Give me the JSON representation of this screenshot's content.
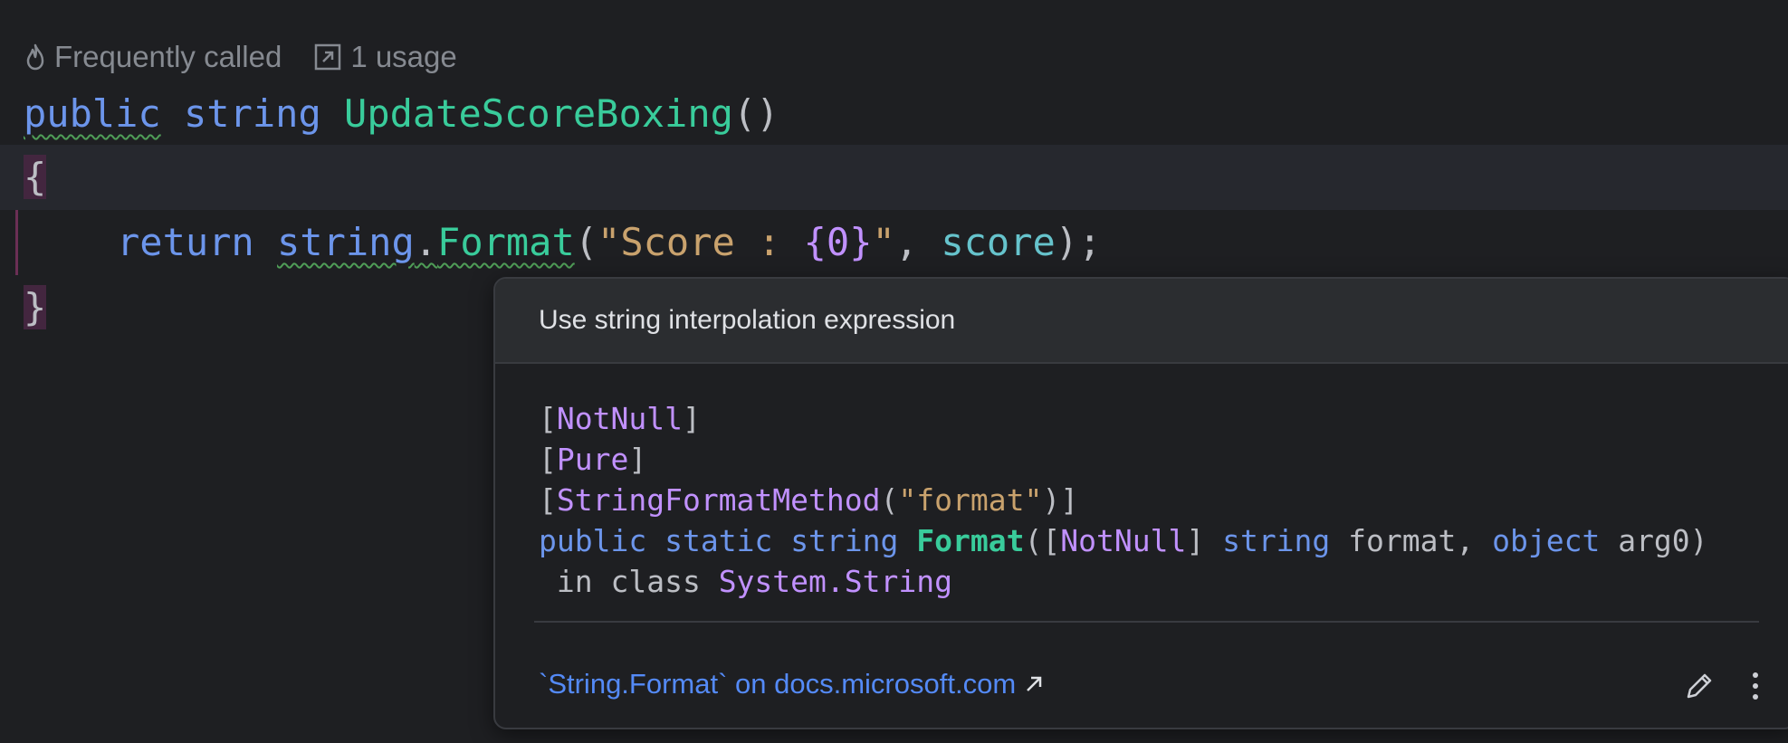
{
  "hints": {
    "frequently_called": "Frequently called",
    "usage": "1 usage"
  },
  "code": {
    "line1": {
      "kw1": "public",
      "kw2": "string",
      "fn": "UpdateScoreBoxing",
      "parens": "()"
    },
    "line2": {
      "brace": "{"
    },
    "line3": {
      "kw": "return",
      "type": "string",
      "dot": ".",
      "fn": "Format",
      "open": "(",
      "str_a": "\"Score : ",
      "placeholder": "{0}",
      "str_b": "\"",
      "comma": ", ",
      "var": "score",
      "close": ");"
    },
    "line4": {
      "brace": "}"
    }
  },
  "popup": {
    "title": "Use string interpolation expression",
    "attr1": {
      "open": "[",
      "name": "NotNull",
      "close": "]"
    },
    "attr2": {
      "open": "[",
      "name": "Pure",
      "close": "]"
    },
    "attr3": {
      "open": "[",
      "name": "StringFormatMethod",
      "paren_open": "(",
      "arg": "\"format\"",
      "paren_close": ")]"
    },
    "signature": {
      "kw1": "public",
      "kw2": "static",
      "kw3": "string",
      "fn": "Format",
      "open": "([",
      "attr": "NotNull",
      "close_attr": "] ",
      "kw4": "string",
      "param1": " format, ",
      "kw5": "object",
      "param2": " arg0)"
    },
    "class_line": {
      "prefix": " in class ",
      "class": "System.String"
    },
    "doc_link": "`String.Format` on docs.microsoft.com"
  },
  "icons": {
    "flame": "flame-icon",
    "usage": "external-link-box-icon",
    "arrow": "arrow-up-right-icon",
    "edit": "pencil-icon",
    "more": "more-vertical-icon"
  }
}
